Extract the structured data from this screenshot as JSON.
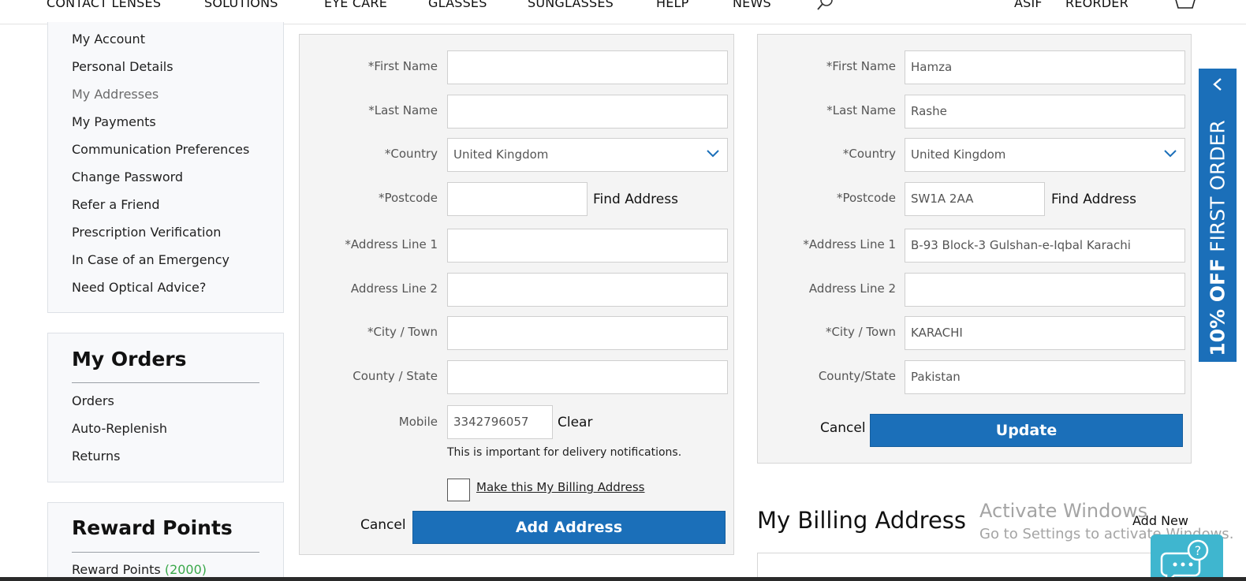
{
  "nav": {
    "items": [
      "CONTACT LENSES",
      "SOLUTIONS",
      "EYE CARE",
      "GLASSES",
      "SUNGLASSES",
      "HELP",
      "NEWS"
    ],
    "user": "ASIF",
    "reorder": "REORDER"
  },
  "account_menu": [
    "My Account",
    "Personal Details",
    "My Addresses",
    "My Payments",
    "Communication Preferences",
    "Change Password",
    "Refer a Friend",
    "Prescription Verification",
    "In Case of an Emergency",
    "Need Optical Advice?"
  ],
  "orders": {
    "title": "My Orders",
    "items": [
      "Orders",
      "Auto-Replenish",
      "Returns"
    ]
  },
  "rewards": {
    "title": "Reward Points",
    "label": "Reward Points",
    "count": "(2000)"
  },
  "new_address_form": {
    "labels": {
      "first_name": "*First Name",
      "last_name": "*Last Name",
      "country": "*Country",
      "postcode": "*Postcode",
      "address1": "*Address Line 1",
      "address2": "Address Line 2",
      "city": "*City / Town",
      "county": "County / State",
      "mobile": "Mobile"
    },
    "values": {
      "first_name": "",
      "last_name": "",
      "country": "United Kingdom",
      "postcode": "",
      "address1": "",
      "address2": "",
      "city": "",
      "county": "",
      "mobile": "3342796057"
    },
    "find_address": "Find Address",
    "clear": "Clear",
    "hint": "This is important for delivery notifications.",
    "billing_checkbox": "Make this My Billing Address",
    "cancel": "Cancel",
    "submit": "Add Address"
  },
  "edit_address_form": {
    "labels": {
      "first_name": "*First Name",
      "last_name": "*Last Name",
      "country": "*Country",
      "postcode": "*Postcode",
      "address1": "*Address Line 1",
      "address2": "Address Line 2",
      "city": "*City / Town",
      "county": "County/State"
    },
    "values": {
      "first_name": "Hamza",
      "last_name": "Rashe",
      "country": "United Kingdom",
      "postcode": "SW1A 2AA",
      "address1": "B-93 Block-3 Gulshan-e-Iqbal Karachi",
      "address2": "",
      "city": "KARACHI",
      "county": "Pakistan"
    },
    "find_address": "Find Address",
    "cancel": "Cancel",
    "submit": "Update"
  },
  "billing": {
    "title": "My Billing Address",
    "add_new": "Add New"
  },
  "promo": {
    "bold": "10% OFF",
    "text": "FIRST ORDER"
  },
  "watermark": {
    "line1": "Activate Windows",
    "line2": "Go to Settings to activate Windows."
  },
  "colors": {
    "primary": "#1b6fb9",
    "rewards_green": "#3aa84a",
    "chat": "#3fb6cf"
  }
}
